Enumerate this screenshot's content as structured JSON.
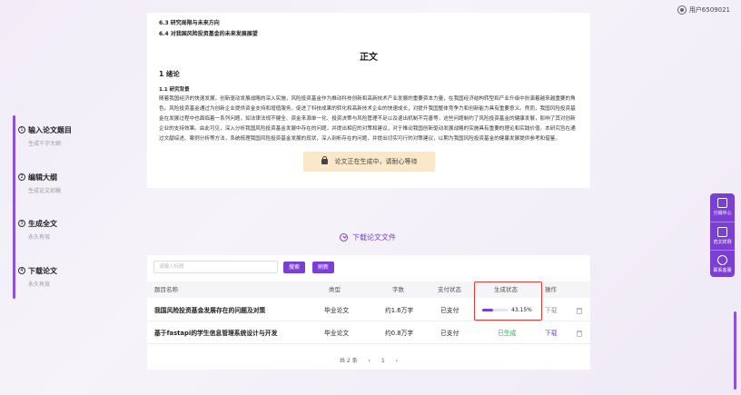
{
  "user": {
    "name": "用户6509021"
  },
  "steps": [
    {
      "num": "1",
      "title": "输入论文题目",
      "sub": "生成千字大纲"
    },
    {
      "num": "2",
      "title": "编辑大纲",
      "sub": "生成论文初稿"
    },
    {
      "num": "3",
      "title": "生成全文",
      "sub": "永久有效"
    },
    {
      "num": "4",
      "title": "下载论文",
      "sub": "永久有效"
    }
  ],
  "document": {
    "toc_63": "6.3 研究局限与未来方向",
    "toc_64": "6.4 对我国风险投资基金的未来发展展望",
    "heading": "正文",
    "chapter": "1 绪论",
    "section": "1.1 研究背景",
    "body": "随着我国经济的快速发展，创新驱动发展战略的深入实施，风险投资基金作为推动科技创新和高新技术产业发展的重要资本力量，在我国经济结构转型和产业升级中扮演着越来越重要的角色。风险投资基金通过为创新企业提供资金支持和增值服务，促进了科技成果的转化和高新技术企业的快速成长，对提升我国整体竞争力和创新能力具有重要意义。然而，我国风险投资基金在发展过程中也面临着一系列问题，如法律法规不健全、资金来源单一化、投资决策与风险管理不足以及退出机制不完善等，这些问题制约了风险投资基金的健康发展，影响了其对创新企业的支持效果。由此可见，深入分析我国风险投资基金发展中存在的问题，并提出相应的对策和建议，对于推动我国创新驱动发展战略的实施具有重要的理论和实践价值。本研究旨在通过文献综述、案例分析等方法，系统梳理我国风险投资基金发展的现状，深入剖析存在的问题，并提出切实可行的对策建议，以期为我国风险投资基金的健康发展提供参考和借鉴。",
    "generating": "论文正在生成中，请耐心等待"
  },
  "download_label": "下载论文文件",
  "table": {
    "search_placeholder": "请输入标题",
    "search_btn": "搜索",
    "refresh_btn": "刷新",
    "headers": [
      "题目名称",
      "类型",
      "字数",
      "支付状态",
      "生成状态",
      "操作"
    ],
    "rows": [
      {
        "name": "我国风险投资基金发展存在的问题及对策",
        "type": "毕业论文",
        "words": "约1.6万字",
        "pay": "已支付",
        "status": "43.15%",
        "progress": 43.15,
        "action": "下载"
      },
      {
        "name": "基于fastapi的学生信息管理系统设计与开发",
        "type": "毕业论文",
        "words": "约0.8万字",
        "pay": "已支付",
        "status": "已生成",
        "action": "下载"
      }
    ],
    "pager_total": "共 2 条",
    "pager_page": "1"
  },
  "right_tools": [
    {
      "label": "分销中心",
      "icon": "sliders-icon"
    },
    {
      "label": "范文样例",
      "icon": "document-icon"
    },
    {
      "label": "联系客服",
      "icon": "headset-icon"
    }
  ],
  "colors": {
    "accent": "#7c3fd6",
    "generated": "#2eaa4c",
    "warning_bg": "#fbe8c8",
    "highlight": "#e53935"
  }
}
